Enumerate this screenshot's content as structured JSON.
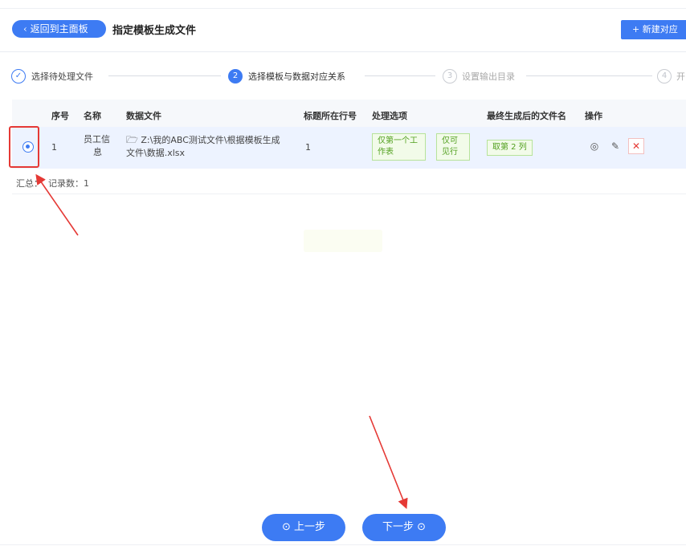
{
  "header": {
    "back_label": "返回到主面板",
    "title": "指定模板生成文件",
    "new_label": "新建对应"
  },
  "steps": [
    {
      "num": "✓",
      "label": "选择待处理文件",
      "state": "done"
    },
    {
      "num": "2",
      "label": "选择模板与数据对应关系",
      "state": "active"
    },
    {
      "num": "3",
      "label": "设置输出目录",
      "state": "wait"
    },
    {
      "num": "4",
      "label": "开",
      "state": "wait"
    }
  ],
  "table": {
    "columns": [
      "序号",
      "名称",
      "数据文件",
      "标题所在行号",
      "处理选项",
      "最终生成后的文件名",
      "操作"
    ],
    "row": {
      "index": "1",
      "name_line1": "员工信",
      "name_line2": "息",
      "file_line1": "Z:\\我的ABC测试文件\\根据模板生成",
      "file_line2": "文件\\数据.xlsx",
      "title_row": "1",
      "option1_line1": "仅第一个工",
      "option1_line2": "作表",
      "option2_line1": "仅可",
      "option2_line2": "见行",
      "output_name": "取第 2 列"
    }
  },
  "summary": {
    "prefix": "汇总：",
    "records_label": "记录数：",
    "records_value": "1"
  },
  "footer": {
    "prev_label": "上一步",
    "next_label": "下一步"
  },
  "colors": {
    "primary": "#3d7bf3",
    "annotation": "#e53935",
    "tag_green": "#52a01f"
  }
}
